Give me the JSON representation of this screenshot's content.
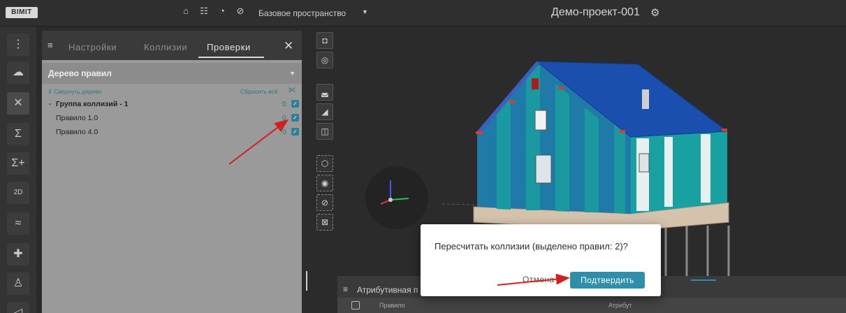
{
  "topbar": {
    "logo": "BIMIT",
    "workspace": "Базовое пространство",
    "project": "Демо-проект-001",
    "icons": [
      "briefcase-icon",
      "people-icon",
      "clash-icon",
      "check-circle-icon"
    ]
  },
  "leftbar": {
    "items": [
      "tree-icon",
      "cloud-icon",
      "collision-icon",
      "sigma-icon",
      "sigma-plus-icon",
      "2d-icon",
      "compare-icon",
      "puzzle-icon",
      "user-check-icon",
      "send-icon"
    ]
  },
  "panel": {
    "tabs": [
      "Настройки",
      "Коллизии",
      "Проверки"
    ],
    "active_tab": "Проверки",
    "tree_select": "Дерево правил",
    "collapse": "Свернуть дерево",
    "reset": "Сбросить всё",
    "rows": [
      {
        "name": "Группа коллизий - 1",
        "count": "0",
        "checked": true
      },
      {
        "name": "Правило 1.0",
        "count": "0",
        "checked": true
      },
      {
        "name": "Правило 4.0",
        "count": "0",
        "checked": true
      }
    ]
  },
  "attr": {
    "title": "Атрибутивная п",
    "col1": "Правило",
    "col2": "Атрибут"
  },
  "dialog": {
    "message": "Пересчитать коллизии (выделено правил: 2)?",
    "cancel": "Отмена",
    "confirm": "Подтвердить"
  },
  "colors": {
    "accent": "#2f8fab",
    "annotation": "#d21f1f"
  }
}
